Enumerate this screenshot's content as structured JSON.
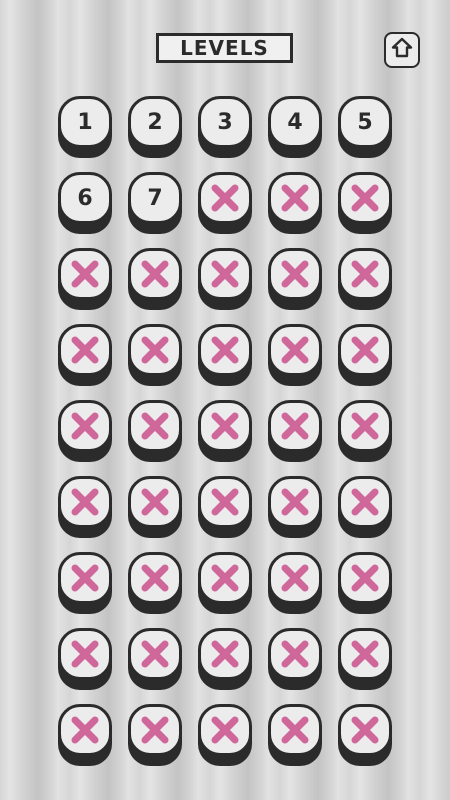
{
  "header": {
    "title": "LEVELS",
    "home_icon": "home-icon"
  },
  "colors": {
    "background_stripe_light": "#e4e4e4",
    "background_stripe_dark": "#c4c4c4",
    "button_face": "#ececec",
    "button_outline": "#2b2b2b",
    "locked_mark": "#d0679a"
  },
  "levels": [
    {
      "label": "1",
      "locked": false
    },
    {
      "label": "2",
      "locked": false
    },
    {
      "label": "3",
      "locked": false
    },
    {
      "label": "4",
      "locked": false
    },
    {
      "label": "5",
      "locked": false
    },
    {
      "label": "6",
      "locked": false
    },
    {
      "label": "7",
      "locked": false
    },
    {
      "label": "",
      "locked": true
    },
    {
      "label": "",
      "locked": true
    },
    {
      "label": "",
      "locked": true
    },
    {
      "label": "",
      "locked": true
    },
    {
      "label": "",
      "locked": true
    },
    {
      "label": "",
      "locked": true
    },
    {
      "label": "",
      "locked": true
    },
    {
      "label": "",
      "locked": true
    },
    {
      "label": "",
      "locked": true
    },
    {
      "label": "",
      "locked": true
    },
    {
      "label": "",
      "locked": true
    },
    {
      "label": "",
      "locked": true
    },
    {
      "label": "",
      "locked": true
    },
    {
      "label": "",
      "locked": true
    },
    {
      "label": "",
      "locked": true
    },
    {
      "label": "",
      "locked": true
    },
    {
      "label": "",
      "locked": true
    },
    {
      "label": "",
      "locked": true
    },
    {
      "label": "",
      "locked": true
    },
    {
      "label": "",
      "locked": true
    },
    {
      "label": "",
      "locked": true
    },
    {
      "label": "",
      "locked": true
    },
    {
      "label": "",
      "locked": true
    },
    {
      "label": "",
      "locked": true
    },
    {
      "label": "",
      "locked": true
    },
    {
      "label": "",
      "locked": true
    },
    {
      "label": "",
      "locked": true
    },
    {
      "label": "",
      "locked": true
    },
    {
      "label": "",
      "locked": true
    },
    {
      "label": "",
      "locked": true
    },
    {
      "label": "",
      "locked": true
    },
    {
      "label": "",
      "locked": true
    },
    {
      "label": "",
      "locked": true
    },
    {
      "label": "",
      "locked": true
    },
    {
      "label": "",
      "locked": true
    },
    {
      "label": "",
      "locked": true
    },
    {
      "label": "",
      "locked": true
    },
    {
      "label": "",
      "locked": true
    }
  ]
}
